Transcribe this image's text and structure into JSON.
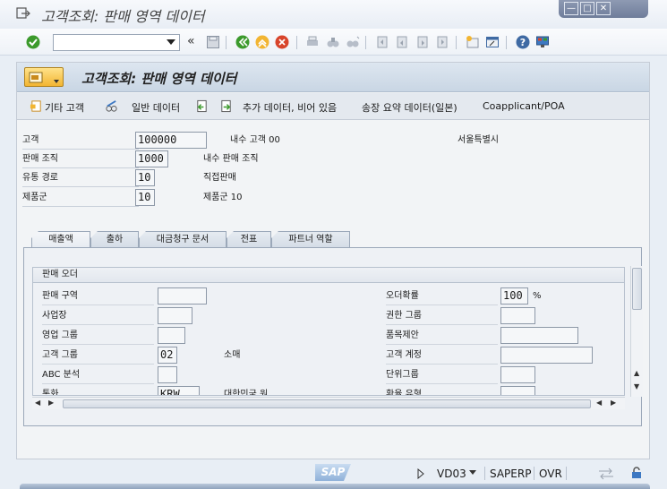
{
  "window": {
    "title": "고객조회: 판매 영역 데이터",
    "controls": [
      "—",
      "□",
      "✕"
    ]
  },
  "toolbar": {
    "command_value": "",
    "nav_back_glyph": "«"
  },
  "panel": {
    "title": "고객조회: 판매 영역 데이터"
  },
  "app_toolbar": {
    "other_customer": "기타 고객",
    "general_data": "일반 데이터",
    "additional_data": "추가 데이터, 비어 있음",
    "invoice_summary": "송장 요약 데이터(일본)",
    "coapplicant": "Coapplicant/POA"
  },
  "header": {
    "customer": {
      "label": "고객",
      "value": "100000",
      "desc": "내수 고객 00",
      "city": "서울특별시"
    },
    "sales_org": {
      "label": "판매 조직",
      "value": "1000",
      "desc": "내수 판매 조직"
    },
    "distr_channel": {
      "label": "유통 경로",
      "value": "10",
      "desc": "직접판매"
    },
    "division": {
      "label": "제품군",
      "value": "10",
      "desc": "제품군 10"
    }
  },
  "tabs": [
    "매출액",
    "출하",
    "대금청구 문서",
    "전표",
    "파트너 역할"
  ],
  "group": {
    "title": "판매 오더",
    "left": [
      {
        "label": "판매 구역",
        "value": ""
      },
      {
        "label": "사업장",
        "value": ""
      },
      {
        "label": "영업 그룹",
        "value": ""
      },
      {
        "label": "고객 그룹",
        "value": "02",
        "desc": "소매"
      },
      {
        "label": "ABC 분석",
        "value": ""
      },
      {
        "label": "통화",
        "value": "KRW",
        "desc": "대한민국 원"
      }
    ],
    "right": [
      {
        "label": "오더확률",
        "value": "100",
        "unit": "%"
      },
      {
        "label": "권한 그룹",
        "value": ""
      },
      {
        "label": "품목제안",
        "value": ""
      },
      {
        "label": "고객 계정",
        "value": ""
      },
      {
        "label": "단위그룹",
        "value": ""
      },
      {
        "label": "환율 유형",
        "value": ""
      }
    ]
  },
  "status": {
    "transaction": "VD03",
    "system": "SAPERP",
    "mode": "OVR",
    "logo": "SAP"
  },
  "colors": {
    "confirm_green": "#3c9a2c",
    "cancel_red": "#d8442a",
    "accent_orange": "#f2b532"
  }
}
